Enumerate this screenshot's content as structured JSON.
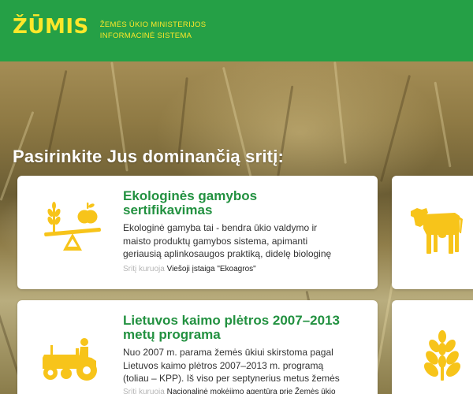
{
  "header": {
    "logo": "ŽŪMIS",
    "tagline_line1": "ŽEMĖS ŪKIO MINISTERIJOS",
    "tagline_line2": "INFORMACINĖ SISTEMA"
  },
  "main": {
    "title": "Pasirinkite Jus dominančią sritį:",
    "cards": [
      {
        "title_line1": "Ekologinės gamybos",
        "title_line2": "sertifikavimas",
        "desc_line1": "Ekologinė gamyba tai - bendra ūkio valdymo ir",
        "desc_line2": "maisto produktų gamybos sistema, apimanti",
        "desc_line3": "geriausią aplinkosaugos praktiką, didelę biologinę",
        "meta_label": "Sritį kuruoja",
        "meta_value": "Viešoji įstaiga \"Ekoagros\"",
        "icon": "scale-wheat-apple-icon"
      },
      {
        "title_line1": "Lietuvos kaimo plėtros 2007–2013",
        "title_line2": "metų programa",
        "desc_line1": "Nuo 2007 m. parama žemės ūkiui skirstoma pagal",
        "desc_line2": "Lietuvos kaimo plėtros 2007–2013 m. programą",
        "desc_line3": "(toliau – KPP). Iš viso per septynerius metus žemės",
        "meta_label": "Sritį kuruoja",
        "meta_value": "Nacionalinė mokėjimo agentūra prie Žemės ūkio",
        "icon": "tractor-icon"
      }
    ],
    "side_cards": [
      {
        "icon": "cow-icon"
      },
      {
        "icon": "wheat-icon"
      }
    ]
  },
  "colors": {
    "header_bg": "#25a046",
    "logo": "#fde72a",
    "card_title": "#229140",
    "icon": "#f7c41a"
  }
}
